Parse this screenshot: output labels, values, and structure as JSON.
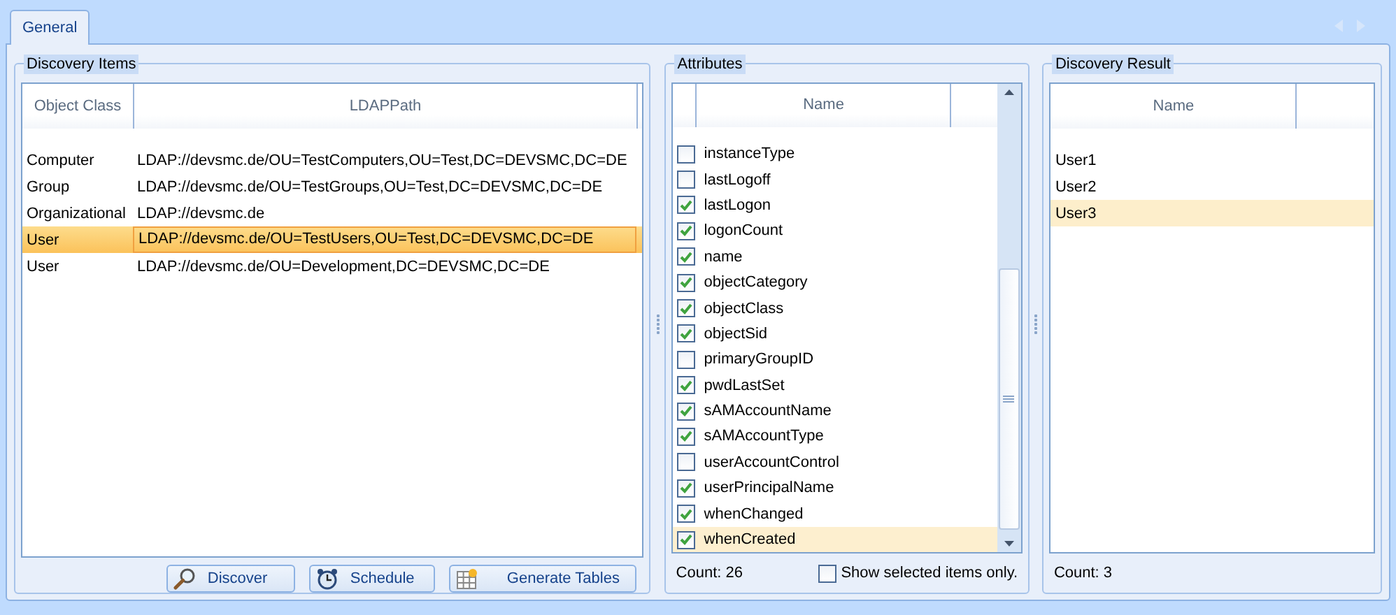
{
  "tabs": [
    {
      "label": "General",
      "selected": true
    }
  ],
  "discovery_items": {
    "title": "Discovery Items",
    "columns": [
      "Object Class",
      "LDAPPath"
    ],
    "rows": [
      {
        "object_class": "Computer",
        "ldap_path": "LDAP://devsmc.de/OU=TestComputers,OU=Test,DC=DEVSMC,DC=DE",
        "selected": false
      },
      {
        "object_class": "Group",
        "ldap_path": "LDAP://devsmc.de/OU=TestGroups,OU=Test,DC=DEVSMC,DC=DE",
        "selected": false
      },
      {
        "object_class": "Organizational",
        "ldap_path": "LDAP://devsmc.de",
        "selected": false
      },
      {
        "object_class": "User",
        "ldap_path": "LDAP://devsmc.de/OU=TestUsers,OU=Test,DC=DEVSMC,DC=DE",
        "selected": true
      },
      {
        "object_class": "User",
        "ldap_path": "LDAP://devsmc.de/OU=Development,DC=DEVSMC,DC=DE",
        "selected": false
      }
    ],
    "buttons": [
      {
        "label": "Discover",
        "kind": "discover"
      },
      {
        "label": "Schedule",
        "kind": "schedule"
      },
      {
        "label": "Generate Tables",
        "kind": "generate"
      }
    ]
  },
  "attributes": {
    "title": "Attributes",
    "column": "Name",
    "items": [
      {
        "name": "instanceType",
        "checked": false,
        "selected": false
      },
      {
        "name": "lastLogoff",
        "checked": false,
        "selected": false
      },
      {
        "name": "lastLogon",
        "checked": true,
        "selected": false
      },
      {
        "name": "logonCount",
        "checked": true,
        "selected": false
      },
      {
        "name": "name",
        "checked": true,
        "selected": false
      },
      {
        "name": "objectCategory",
        "checked": true,
        "selected": false
      },
      {
        "name": "objectClass",
        "checked": true,
        "selected": false
      },
      {
        "name": "objectSid",
        "checked": true,
        "selected": false
      },
      {
        "name": "primaryGroupID",
        "checked": false,
        "selected": false
      },
      {
        "name": "pwdLastSet",
        "checked": true,
        "selected": false
      },
      {
        "name": "sAMAccountName",
        "checked": true,
        "selected": false
      },
      {
        "name": "sAMAccountType",
        "checked": true,
        "selected": false
      },
      {
        "name": "userAccountControl",
        "checked": false,
        "selected": false
      },
      {
        "name": "userPrincipalName",
        "checked": true,
        "selected": false
      },
      {
        "name": "whenChanged",
        "checked": true,
        "selected": false
      },
      {
        "name": "whenCreated",
        "checked": true,
        "selected": true
      }
    ],
    "count": "Count: 26",
    "show_selected_only": {
      "label": "Show selected items only.",
      "checked": false
    }
  },
  "discovery_result": {
    "title": "Discovery Result",
    "column": "Name",
    "rows": [
      {
        "name": "User1",
        "selected": false
      },
      {
        "name": "User2",
        "selected": false
      },
      {
        "name": "User3",
        "selected": true
      }
    ],
    "count": "Count: 3"
  }
}
